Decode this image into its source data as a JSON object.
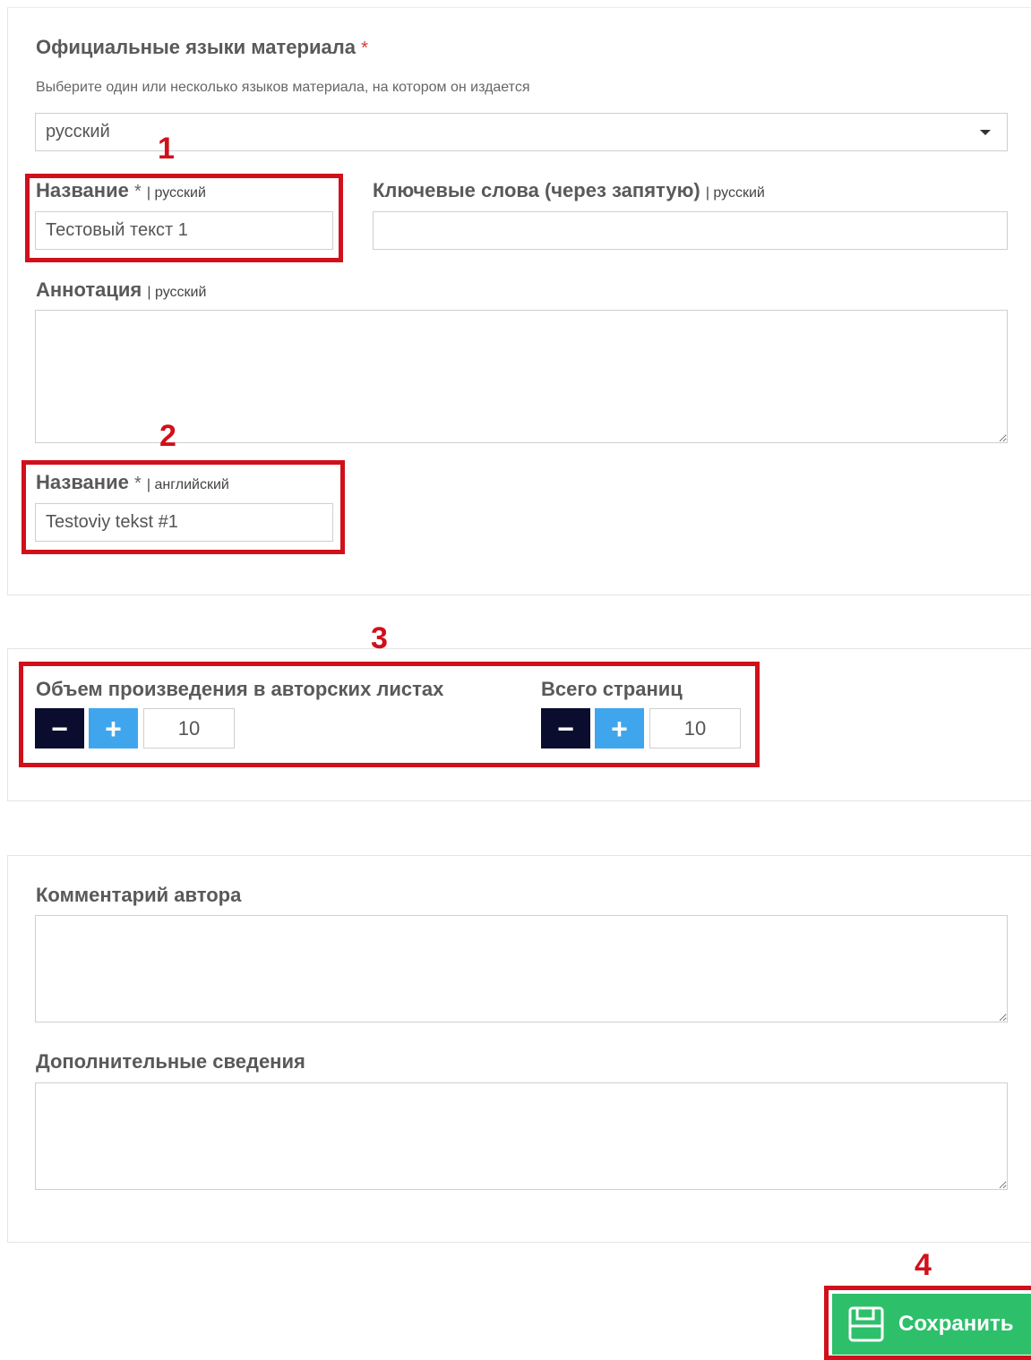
{
  "languages": {
    "label": "Официальные языки материала",
    "required_mark": "*",
    "hint": "Выберите один или несколько языков материала, на котором он издается",
    "selected": "русский"
  },
  "title_ru": {
    "label": "Название",
    "required_mark": "*",
    "lang": "| русский",
    "value": "Тестовый текст 1"
  },
  "keywords": {
    "label": "Ключевые слова (через запятую)",
    "lang": "| русский",
    "value": ""
  },
  "annotation": {
    "label": "Аннотация",
    "lang": "| русский",
    "value": ""
  },
  "title_en": {
    "label": "Название",
    "required_mark": "*",
    "lang": "| английский",
    "value": "Testoviy tekst #1"
  },
  "volume": {
    "label": "Объем произведения в авторских листах",
    "minus": "−",
    "plus": "+",
    "value": "10"
  },
  "pages": {
    "label": "Всего страниц",
    "minus": "−",
    "plus": "+",
    "value": "10"
  },
  "author_comment": {
    "label": "Комментарий автора",
    "value": ""
  },
  "additional_info": {
    "label": "Дополнительные сведения",
    "value": ""
  },
  "save": {
    "label": "Сохранить",
    "icon": "save-icon"
  },
  "markers": {
    "m1": "1",
    "m2": "2",
    "m3": "3",
    "m4": "4"
  },
  "colors": {
    "marker_red": "#d0101b",
    "save_green": "#2ebf6b",
    "minus_dark": "#0b0d2e",
    "plus_blue": "#3fa6ee"
  }
}
